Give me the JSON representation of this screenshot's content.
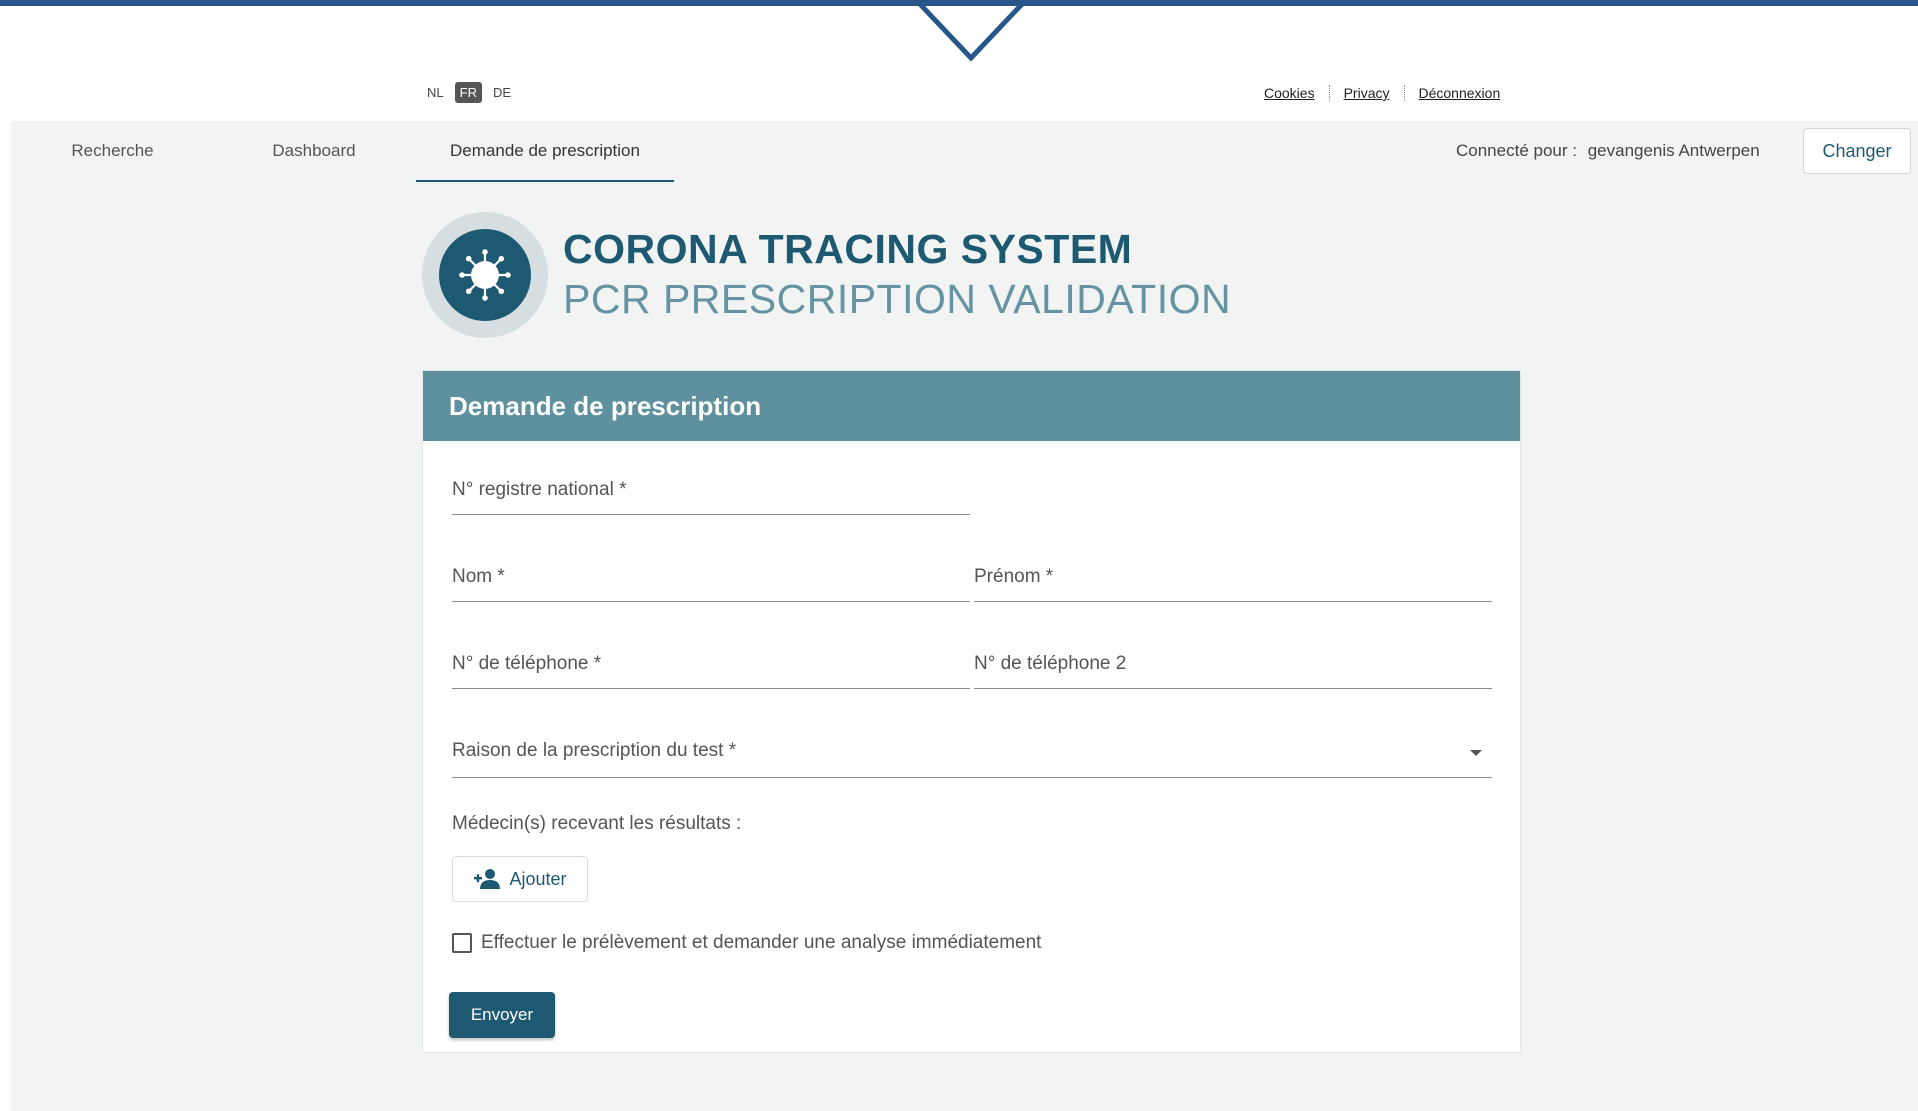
{
  "languages": [
    {
      "code": "NL",
      "active": false
    },
    {
      "code": "FR",
      "active": true
    },
    {
      "code": "DE",
      "active": false
    }
  ],
  "top_links": [
    "Cookies",
    "Privacy",
    "Déconnexion"
  ],
  "nav": {
    "tabs": [
      "Recherche",
      "Dashboard",
      "Demande de prescription"
    ],
    "active_tab": "Demande de prescription"
  },
  "session": {
    "connected_label": "Connecté pour :",
    "organization": "gevangenis Antwerpen",
    "change_button": "Changer"
  },
  "branding": {
    "title": "CORONA TRACING SYSTEM",
    "subtitle": "PCR PRESCRIPTION VALIDATION",
    "logo_icon": "virus-icon"
  },
  "form": {
    "heading": "Demande de prescription",
    "fields": {
      "national_register": "N° registre national *",
      "last_name": "Nom *",
      "first_name": "Prénom *",
      "phone1": "N° de téléphone *",
      "phone2": "N° de téléphone 2",
      "reason": "Raison de la prescription du test *"
    },
    "doctors_label": "Médecin(s) recevant les résultats :",
    "add_button": "Ajouter",
    "add_icon": "add-person-icon",
    "immediate_checkbox_label": "Effectuer le prélèvement et demander une analyse immédiatement",
    "immediate_checked": false,
    "submit_button": "Envoyer"
  },
  "colors": {
    "primary": "#1e5972",
    "header_band": "#5e919d",
    "top_bar": "#27578a",
    "page_background": "#f2f4f4"
  }
}
